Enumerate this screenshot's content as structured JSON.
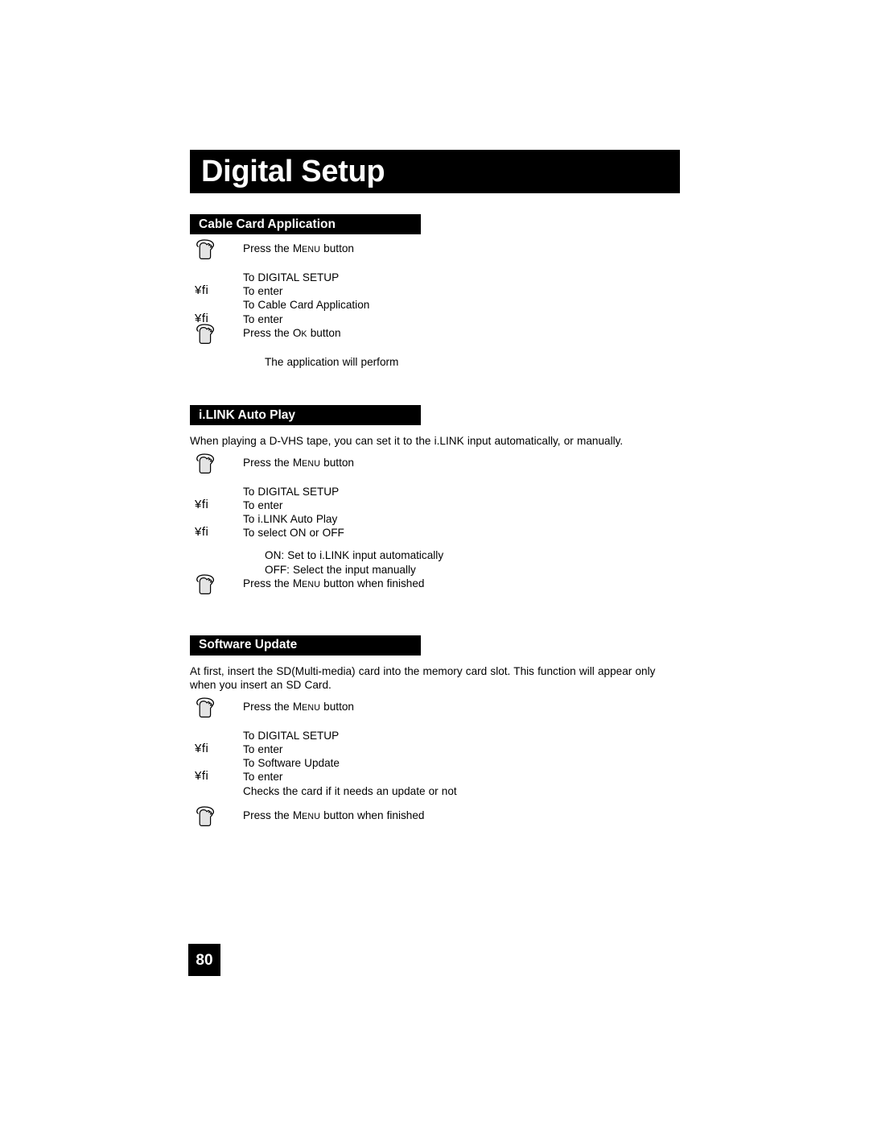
{
  "page": {
    "title": "Digital Setup",
    "number": "80"
  },
  "icons": {
    "press_button": "hand-press-icon",
    "arrow_glyph": "¥fi"
  },
  "sections": [
    {
      "heading": "Cable Card Application",
      "intro": null,
      "steps": [
        {
          "marker": "hand",
          "text_pre": "Press the ",
          "sc_first": "M",
          "sc_rest": "ENU",
          "text_post": " button",
          "indent": 0,
          "gap": "none"
        },
        {
          "marker": "none",
          "text": "To DIGITAL SETUP",
          "indent": 0,
          "gap": "small"
        },
        {
          "marker": "arrow",
          "text": "To enter",
          "indent": 0,
          "gap": "none"
        },
        {
          "marker": "none",
          "text": "To Cable Card Application",
          "indent": 0,
          "gap": "none"
        },
        {
          "marker": "arrow",
          "text": "To enter",
          "indent": 0,
          "gap": "none"
        },
        {
          "marker": "hand",
          "text_pre": "Press the ",
          "sc_first": "O",
          "sc_rest": "K",
          "text_post": " button",
          "indent": 0,
          "gap": "none"
        },
        {
          "marker": "none",
          "text": "The application will perform",
          "indent": 1,
          "gap": "small"
        }
      ]
    },
    {
      "heading": "i.LINK Auto Play",
      "intro": "When playing a D-VHS tape, you can set it to the i.LINK input automatically, or manually.",
      "steps": [
        {
          "marker": "hand",
          "text_pre": "Press the ",
          "sc_first": "M",
          "sc_rest": "ENU",
          "text_post": " button",
          "indent": 0,
          "gap": "none"
        },
        {
          "marker": "none",
          "text": "To DIGITAL SETUP",
          "indent": 0,
          "gap": "small"
        },
        {
          "marker": "arrow",
          "text": "To enter",
          "indent": 0,
          "gap": "none"
        },
        {
          "marker": "none",
          "text": "To i.LINK Auto Play",
          "indent": 0,
          "gap": "none"
        },
        {
          "marker": "arrow",
          "text": "To select ON or OFF",
          "indent": 0,
          "gap": "none"
        },
        {
          "marker": "none",
          "text": "ON:  Set to i.LINK input automatically",
          "indent": 1,
          "gap": "small"
        },
        {
          "marker": "none",
          "text": "OFF:  Select the input manually",
          "indent": 1,
          "gap": "none"
        },
        {
          "marker": "hand",
          "text_pre": "Press the ",
          "sc_first": "M",
          "sc_rest": "ENU",
          "text_post": " button when finished",
          "indent": 0,
          "gap": "none"
        }
      ]
    },
    {
      "heading": "Software Update",
      "intro": "At first, insert the SD(Multi-media) card into the memory card slot.  This function will appear only when you insert an SD Card.",
      "steps": [
        {
          "marker": "hand",
          "text_pre": "Press the ",
          "sc_first": "M",
          "sc_rest": "ENU",
          "text_post": " button",
          "indent": 0,
          "gap": "none"
        },
        {
          "marker": "none",
          "text": "To DIGITAL SETUP",
          "indent": 0,
          "gap": "small"
        },
        {
          "marker": "arrow",
          "text": "To enter",
          "indent": 0,
          "gap": "none"
        },
        {
          "marker": "none",
          "text": "To Software Update",
          "indent": 0,
          "gap": "none"
        },
        {
          "marker": "arrow",
          "text": "To enter",
          "indent": 0,
          "gap": "none"
        },
        {
          "marker": "none",
          "text": "Checks the card if it needs an update or not",
          "indent": 0,
          "gap": "none"
        },
        {
          "marker": "hand",
          "text_pre": "Press the ",
          "sc_first": "M",
          "sc_rest": "ENU",
          "text_post": " button when finished",
          "indent": 0,
          "gap": "medium"
        }
      ]
    }
  ],
  "colors": {
    "bar_background": "#000000",
    "bar_text": "#ffffff",
    "body_text": "#000000",
    "page_background": "#ffffff"
  }
}
